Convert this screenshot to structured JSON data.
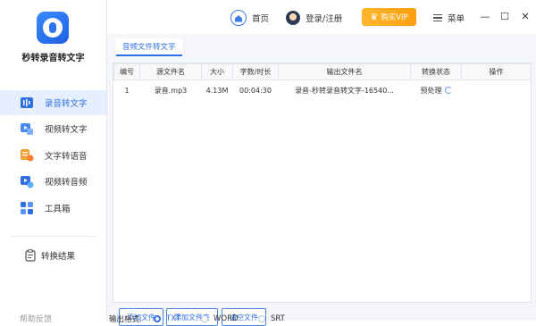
{
  "app": {
    "name": "秒转录音转文字"
  },
  "sidebar": {
    "items": [
      {
        "label": "录音转文字",
        "icon": "mic-audio-icon",
        "active": true
      },
      {
        "label": "视频转文字",
        "icon": "video-text-icon"
      },
      {
        "label": "文字转语音",
        "icon": "text-speech-icon"
      },
      {
        "label": "视频转音频",
        "icon": "video-audio-icon"
      },
      {
        "label": "工具箱",
        "icon": "toolbox-icon"
      }
    ],
    "result": {
      "label": "转换结果",
      "icon": "clipboard-icon"
    },
    "bottom_partial": "帮助反馈"
  },
  "header": {
    "home": "首页",
    "login": "登录/注册",
    "vip": "购买VIP",
    "menu": "菜单",
    "window": {
      "minimize": "—",
      "maximize": "☐",
      "close": "✕"
    }
  },
  "tab": {
    "label": "音频文件转文字"
  },
  "table": {
    "columns": [
      "编号",
      "源文件名",
      "大小",
      "字数/时长",
      "输出文件名",
      "转换状态",
      "操作"
    ],
    "rows": [
      {
        "no": "1",
        "name": "录音.mp3",
        "size": "4.13M",
        "duration": "00:04:30",
        "output": "录音-秒转录音转文字-16540...",
        "status": "预处理",
        "action": ""
      }
    ]
  },
  "buttons": {
    "add_file": "添加文件",
    "add_folder": "添加文件夹",
    "clear": "清空文件"
  },
  "format": {
    "label": "输出格式:",
    "options": [
      "TXT",
      "WORD",
      "SRT"
    ],
    "selected": "TXT"
  },
  "colors": {
    "accent": "#2f6fe4",
    "vip": "#ffa51f",
    "active_bg": "#e6efff"
  }
}
